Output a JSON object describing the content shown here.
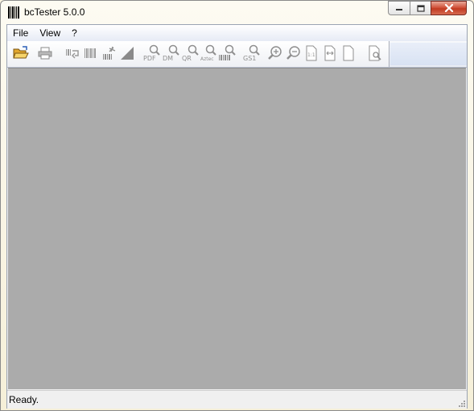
{
  "window": {
    "title": "bcTester 5.0.0",
    "controls": [
      "minimize-icon",
      "maximize-icon",
      "close-icon"
    ]
  },
  "menu": [
    {
      "label": "File"
    },
    {
      "label": "View"
    },
    {
      "label": "?"
    }
  ],
  "toolbar": {
    "icons": [
      "open-folder-icon",
      "print-icon",
      "barcode-scan-icon",
      "barcode-icon",
      "barcode-decode-icon",
      "triangle-icon",
      "pdf417-search-icon",
      "datamatrix-search-icon",
      "qr-search-icon",
      "aztec-search-icon",
      "linear-search-icon",
      "gs1-search-icon",
      "zoom-in-icon",
      "zoom-out-icon",
      "actual-size-icon",
      "fit-width-icon",
      "fit-page-icon",
      "properties-icon"
    ],
    "labels": {
      "pdf": "PDF",
      "dm": "DM",
      "qr": "QR",
      "aztec": "Aztec",
      "gs1": "GS1",
      "one_to_one": "1:1"
    }
  },
  "status": {
    "text": "Ready."
  },
  "colors": {
    "workspace": "#ababab",
    "close_button": "#c9452c",
    "frame": "#f8f3df"
  }
}
